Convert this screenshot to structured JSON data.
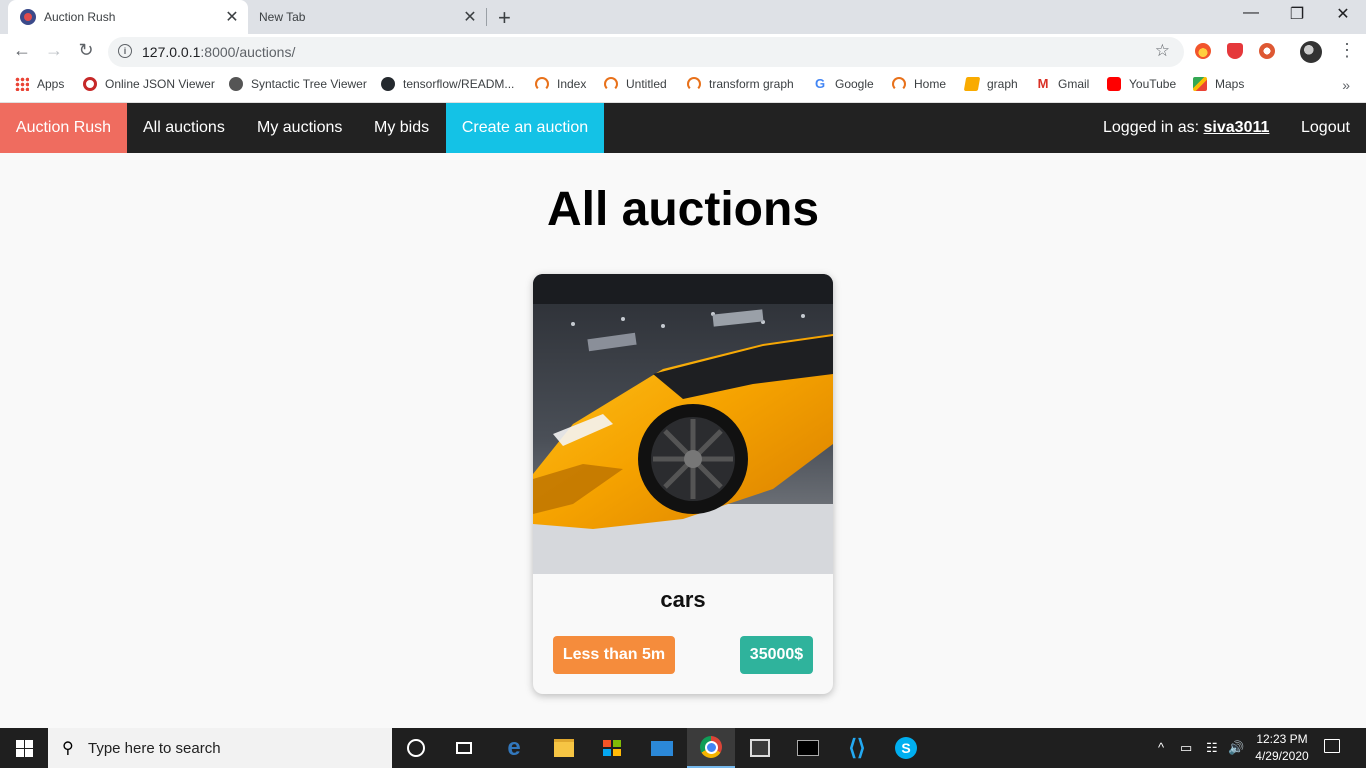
{
  "browser": {
    "tabs": [
      {
        "title": "Auction Rush",
        "active": true
      },
      {
        "title": "New Tab",
        "active": false
      }
    ],
    "url_host": "127.0.0.1",
    "url_path": ":8000/auctions/",
    "bookmarks": [
      {
        "label": "Apps",
        "icon": "apps-grid-icon"
      },
      {
        "label": "Online JSON Viewer",
        "icon": "json-viewer-icon"
      },
      {
        "label": "Syntactic Tree Viewer",
        "icon": "globe-icon"
      },
      {
        "label": "tensorflow/READM...",
        "icon": "github-icon"
      },
      {
        "label": "Index",
        "icon": "jupyter-icon"
      },
      {
        "label": "Untitled",
        "icon": "jupyter-icon"
      },
      {
        "label": "transform graph",
        "icon": "jupyter-icon"
      },
      {
        "label": "Google",
        "icon": "google-icon"
      },
      {
        "label": "Home",
        "icon": "jupyter-icon"
      },
      {
        "label": "graph",
        "icon": "book-icon"
      },
      {
        "label": "Gmail",
        "icon": "gmail-icon"
      },
      {
        "label": "YouTube",
        "icon": "youtube-icon"
      },
      {
        "label": "Maps",
        "icon": "maps-icon"
      }
    ]
  },
  "nav": {
    "brand": "Auction Rush",
    "all_auctions": "All auctions",
    "my_auctions": "My auctions",
    "my_bids": "My bids",
    "create": "Create an auction",
    "logged_prefix": "Logged in as: ",
    "username": "siva3011",
    "logout": "Logout",
    "colors": {
      "brand_bg": "#ef6c5f",
      "create_bg": "#14c2e6",
      "bar_bg": "#222222"
    }
  },
  "main": {
    "title": "All auctions",
    "auctions": [
      {
        "name": "cars",
        "image": "yellow-sports-car-photo",
        "time_left": "Less than 5m",
        "price": "35000$",
        "colors": {
          "time": "#f58c3c",
          "price": "#2fb39c"
        }
      }
    ]
  },
  "taskbar": {
    "search_placeholder": "Type here to search",
    "time": "12:23 PM",
    "date": "4/29/2020",
    "apps": [
      "cortana-icon",
      "task-view-icon",
      "edge-icon",
      "file-explorer-icon",
      "store-icon",
      "mail-icon",
      "chrome-icon",
      "video-editor-icon",
      "terminal-icon",
      "vscode-icon",
      "skype-icon"
    ]
  }
}
